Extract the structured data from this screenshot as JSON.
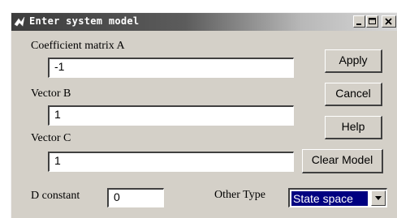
{
  "window": {
    "title": "Enter system model"
  },
  "form": {
    "coeff_a_label": "Coefficient matrix A",
    "coeff_a_value": "-1",
    "vector_b_label": "Vector B",
    "vector_b_value": "1",
    "vector_c_label": "Vector C",
    "vector_c_value": "1",
    "d_constant_label": "D constant",
    "d_constant_value": "0",
    "other_type_label": "Other Type",
    "other_type_selected": "State space"
  },
  "buttons": {
    "apply": "Apply",
    "cancel": "Cancel",
    "help": "Help",
    "clear_model": "Clear Model"
  },
  "icons": {
    "title_icon": "matlab-logo-icon",
    "minimize": "minimize-icon",
    "maximize": "maximize-icon",
    "close": "close-icon",
    "dropdown": "chevron-down-icon"
  },
  "colors": {
    "dialog_face": "#d4d0c8",
    "selection": "#000080",
    "titlebar_dark": "#3c3c3c"
  }
}
